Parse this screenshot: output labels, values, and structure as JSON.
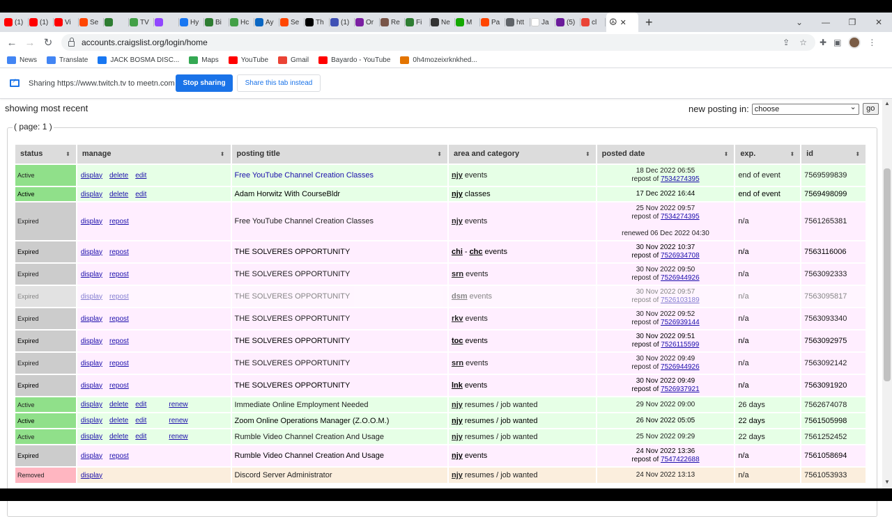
{
  "browser": {
    "tabs": [
      {
        "title": "(1)",
        "color": "#ff0000"
      },
      {
        "title": "(1)",
        "color": "#ff0000"
      },
      {
        "title": "Vi",
        "color": "#ff0000"
      },
      {
        "title": "Se",
        "color": "#ff4500"
      },
      {
        "title": "",
        "color": "#2e7d32"
      },
      {
        "title": "TV",
        "color": "#43a047"
      },
      {
        "title": "",
        "color": "#9146ff"
      },
      {
        "title": "Hy",
        "color": "#1877f2"
      },
      {
        "title": "Bi",
        "color": "#2e7d32"
      },
      {
        "title": "Hc",
        "color": "#43a047"
      },
      {
        "title": "Ay",
        "color": "#0a66c2"
      },
      {
        "title": "Se",
        "color": "#ff4500"
      },
      {
        "title": "Th",
        "color": "#000000"
      },
      {
        "title": "(1)",
        "color": "#3f51b5"
      },
      {
        "title": "Or",
        "color": "#7b1fa2"
      },
      {
        "title": "Re",
        "color": "#795548"
      },
      {
        "title": "Fi",
        "color": "#2e7d32"
      },
      {
        "title": "Ne",
        "color": "#333333"
      },
      {
        "title": "M",
        "color": "#14a800"
      },
      {
        "title": "Pa",
        "color": "#ff4500"
      },
      {
        "title": "htt",
        "color": "#5f6368"
      },
      {
        "title": "Ja",
        "color": "#ffffff"
      },
      {
        "title": "(5)",
        "color": "#6a1b9a"
      },
      {
        "title": "cl",
        "color": "#ea4335"
      }
    ],
    "active_tab_icon": "☮",
    "new_tab": "+",
    "url": "accounts.craigslist.org/login/home",
    "bookmarks": [
      {
        "label": "News",
        "color": "#4285f4"
      },
      {
        "label": "Translate",
        "color": "#4285f4"
      },
      {
        "label": "JACK BOSMA DISC...",
        "color": "#1877f2"
      },
      {
        "label": "Maps",
        "color": "#34a853"
      },
      {
        "label": "YouTube",
        "color": "#ff0000"
      },
      {
        "label": "Gmail",
        "color": "#ea4335"
      },
      {
        "label": "Bayardo - YouTube",
        "color": "#ff0000"
      },
      {
        "label": "0h4mozeixrknkhed...",
        "color": "#e37400"
      }
    ]
  },
  "sharebar": {
    "text": "Sharing https://www.twitch.tv to meetn.com",
    "stop_label": "Stop sharing",
    "share_tab_label": "Share this tab instead"
  },
  "page": {
    "showing": "showing most recent",
    "new_posting_label": "new posting in:",
    "new_posting_value": "choose",
    "go_label": "go",
    "page_label": "( page: 1 )"
  },
  "table": {
    "headers": [
      "status",
      "manage",
      "posting title",
      "area and category",
      "posted date",
      "exp.",
      "id"
    ],
    "colors": {
      "active_status": "#90e08a",
      "active_row": "#e6ffe6",
      "expired_status": "#cccccc",
      "expired_row": "#ffeeff",
      "removed_status": "#ffb6c1",
      "removed_row": "#fbeedd"
    },
    "rows": [
      {
        "status": "Active",
        "kind": "active",
        "actions": [
          "display",
          "delete",
          "edit"
        ],
        "title": "Free YouTube Channel Creation Classes",
        "area": "njy",
        "area2": "",
        "category": "events",
        "date": "18 Dec 2022 06:55",
        "repost_of": "7534274395",
        "renewed": "",
        "exp": "end of event",
        "id": "7569599839",
        "h": 30,
        "blue": true
      },
      {
        "status": "Active",
        "kind": "active",
        "actions": [
          "display",
          "delete",
          "edit"
        ],
        "title": "Adam Horwitz With CourseBldr",
        "area": "njy",
        "area2": "",
        "category": "classes",
        "date": "17 Dec 2022 16:44",
        "repost_of": "",
        "renewed": "",
        "exp": "end of event",
        "id": "7569498099",
        "h": 20,
        "bold": true
      },
      {
        "status": "Expired",
        "kind": "expired",
        "actions": [
          "display",
          "repost"
        ],
        "title": "Free YouTube Channel Creation Classes",
        "area": "njy",
        "area2": "",
        "category": "events",
        "date": "25 Nov 2022 09:57",
        "repost_of": "7534274395",
        "renewed": "renewed 06 Dec 2022 04:30",
        "exp": "n/a",
        "id": "7561265381",
        "h": 54
      },
      {
        "status": "Expired",
        "kind": "expired",
        "actions": [
          "display",
          "repost"
        ],
        "title": "THE SOLVERES OPPORTUNITY",
        "area": "chi",
        "area2": "chc",
        "category": "events",
        "date": "30 Nov 2022 10:37",
        "repost_of": "7526934708",
        "renewed": "",
        "exp": "n/a",
        "id": "7563116006",
        "h": 30,
        "bold": true
      },
      {
        "status": "Expired",
        "kind": "expired",
        "actions": [
          "display",
          "repost"
        ],
        "title": "THE SOLVERES OPPORTUNITY",
        "area": "srn",
        "area2": "",
        "category": "events",
        "date": "30 Nov 2022 09:50",
        "repost_of": "7526944926",
        "renewed": "",
        "exp": "n/a",
        "id": "7563092333",
        "h": 30
      },
      {
        "status": "Expired",
        "kind": "expired",
        "actions": [
          "display",
          "repost"
        ],
        "title": "THE SOLVERES OPPORTUNITY",
        "area": "dsm",
        "area2": "",
        "category": "events",
        "date": "30 Nov 2022 09:57",
        "repost_of": "7526103189",
        "renewed": "",
        "exp": "n/a",
        "id": "7563095817",
        "h": 30,
        "faded": true
      },
      {
        "status": "Expired",
        "kind": "expired",
        "actions": [
          "display",
          "repost"
        ],
        "title": "THE SOLVERES OPPORTUNITY",
        "area": "rkv",
        "area2": "",
        "category": "events",
        "date": "30 Nov 2022 09:52",
        "repost_of": "7526939144",
        "renewed": "",
        "exp": "n/a",
        "id": "7563093340",
        "h": 30
      },
      {
        "status": "Expired",
        "kind": "expired",
        "actions": [
          "display",
          "repost"
        ],
        "title": "THE SOLVERES OPPORTUNITY",
        "area": "toc",
        "area2": "",
        "category": "events",
        "date": "30 Nov 2022 09:51",
        "repost_of": "7526115599",
        "renewed": "",
        "exp": "n/a",
        "id": "7563092975",
        "h": 30,
        "bold": true
      },
      {
        "status": "Expired",
        "kind": "expired",
        "actions": [
          "display",
          "repost"
        ],
        "title": "THE SOLVERES OPPORTUNITY",
        "area": "srn",
        "area2": "",
        "category": "events",
        "date": "30 Nov 2022 09:49",
        "repost_of": "7526944926",
        "renewed": "",
        "exp": "n/a",
        "id": "7563092142",
        "h": 30
      },
      {
        "status": "Expired",
        "kind": "expired",
        "actions": [
          "display",
          "repost"
        ],
        "title": "THE SOLVERES OPPORTUNITY",
        "area": "lnk",
        "area2": "",
        "category": "events",
        "date": "30 Nov 2022 09:49",
        "repost_of": "7526937921",
        "renewed": "",
        "exp": "n/a",
        "id": "7563091920",
        "h": 30,
        "bold": true
      },
      {
        "status": "Active",
        "kind": "active",
        "actions": [
          "display",
          "delete",
          "edit",
          "renew"
        ],
        "title": "Immediate Online Employment Needed",
        "area": "njy",
        "area2": "",
        "category": "resumes / job wanted",
        "date": "29 Nov 2022 09:00",
        "repost_of": "",
        "renewed": "",
        "exp": "26 days",
        "id": "7562674078",
        "h": 21
      },
      {
        "status": "Active",
        "kind": "active",
        "actions": [
          "display",
          "delete",
          "edit",
          "renew"
        ],
        "title": "Zoom Online Operations Manager (Z.O.O.M.)",
        "area": "njy",
        "area2": "",
        "category": "resumes / job wanted",
        "date": "26 Nov 2022 05:05",
        "repost_of": "",
        "renewed": "",
        "exp": "22 days",
        "id": "7561505998",
        "h": 21,
        "bold": true
      },
      {
        "status": "Active",
        "kind": "active",
        "actions": [
          "display",
          "delete",
          "edit",
          "renew"
        ],
        "title": "Rumble Video Channel Creation And Usage",
        "area": "njy",
        "area2": "",
        "category": "resumes / job wanted",
        "date": "25 Nov 2022 09:29",
        "repost_of": "",
        "renewed": "",
        "exp": "22 days",
        "id": "7561252452",
        "h": 21
      },
      {
        "status": "Expired",
        "kind": "expired",
        "actions": [
          "display",
          "repost"
        ],
        "title": "Rumble Video Channel Creation And Usage",
        "area": "njy",
        "area2": "",
        "category": "events",
        "date": "24 Nov 2022 13:36",
        "repost_of": "7547422688",
        "renewed": "",
        "exp": "n/a",
        "id": "7561058694",
        "h": 30,
        "bold": true
      },
      {
        "status": "Removed",
        "kind": "removed",
        "actions": [
          "display"
        ],
        "title": "Discord Server Administrator",
        "area": "njy",
        "area2": "",
        "category": "resumes / job wanted",
        "date": "24 Nov 2022 13:13",
        "repost_of": "",
        "renewed": "",
        "exp": "n/a",
        "id": "7561053933",
        "h": 22
      }
    ],
    "repost_prefix": "repost of "
  }
}
